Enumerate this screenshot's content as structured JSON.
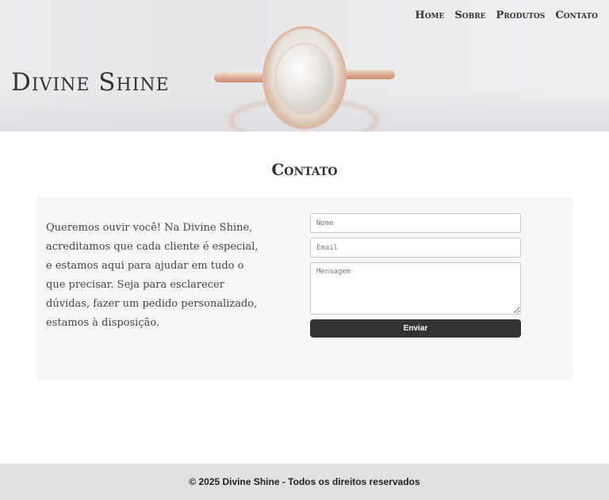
{
  "brand": "Divine Shine",
  "nav": {
    "items": [
      {
        "label": "Home"
      },
      {
        "label": "Sobre"
      },
      {
        "label": "Produtos"
      },
      {
        "label": "Contato"
      }
    ]
  },
  "hero": {
    "image_icon": "ring-image"
  },
  "contact": {
    "title": "Contato",
    "intro": "Queremos ouvir você! Na Divine Shine, acreditamos que cada cliente é especial, e estamos aqui para ajudar em tudo o que precisar. Seja para esclarecer dúvidas, fazer um pedido personalizado, estamos à disposição.",
    "form": {
      "name_placeholder": "Nome",
      "email_placeholder": "Email",
      "message_placeholder": "Mensagem",
      "submit_label": "Enviar"
    }
  },
  "footer": {
    "text": "© 2025 Divine Shine - Todos os direitos reservados"
  },
  "colors": {
    "dark": "#333333",
    "card": "#f7f7f7",
    "footer": "#e2e0e0"
  }
}
